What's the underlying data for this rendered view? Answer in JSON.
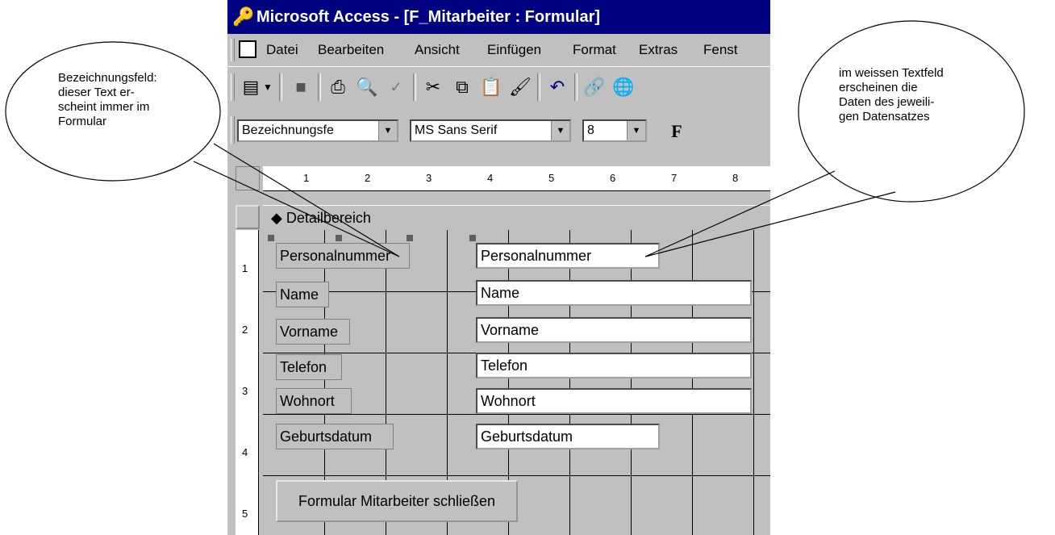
{
  "window": {
    "title": "Microsoft Access - [F_Mitarbeiter : Formular]"
  },
  "menu": {
    "items": [
      "Datei",
      "Bearbeiten",
      "Ansicht",
      "Einfügen",
      "Format",
      "Extras",
      "Fenst"
    ]
  },
  "formatting": {
    "object_combo": "Bezeichnungsfe",
    "font_combo": "MS Sans Serif",
    "size_combo": "8",
    "bold_label": "F"
  },
  "ruler": {
    "h_ticks": [
      "1",
      "2",
      "3",
      "4",
      "5",
      "6",
      "7",
      "8"
    ],
    "v_ticks": [
      "1",
      "2",
      "3",
      "4",
      "5"
    ]
  },
  "section": {
    "title": "Detailbereich"
  },
  "form": {
    "labels": [
      "Personalnummer",
      "Name",
      "Vorname",
      "Telefon",
      "Wohnort",
      "Geburtsdatum"
    ],
    "fields": [
      "Personalnummer",
      "Name",
      "Vorname",
      "Telefon",
      "Wohnort",
      "Geburtsdatum"
    ],
    "close_button": "Formular Mitarbeiter schließen"
  },
  "callouts": {
    "left": "Bezeichnungsfeld:\ndieser Text er-\nscheint immer im\nFormular",
    "right": "im weissen Textfeld\nerscheinen die\nDaten des jeweili-\ngen Datensatzes"
  },
  "icons": [
    "access-key-icon",
    "form-view-icon",
    "save-icon",
    "print-icon",
    "print-preview-icon",
    "spelling-icon",
    "cut-icon",
    "copy-icon",
    "paste-icon",
    "format-painter-icon",
    "undo-icon",
    "hyperlink-icon",
    "web-icon"
  ]
}
